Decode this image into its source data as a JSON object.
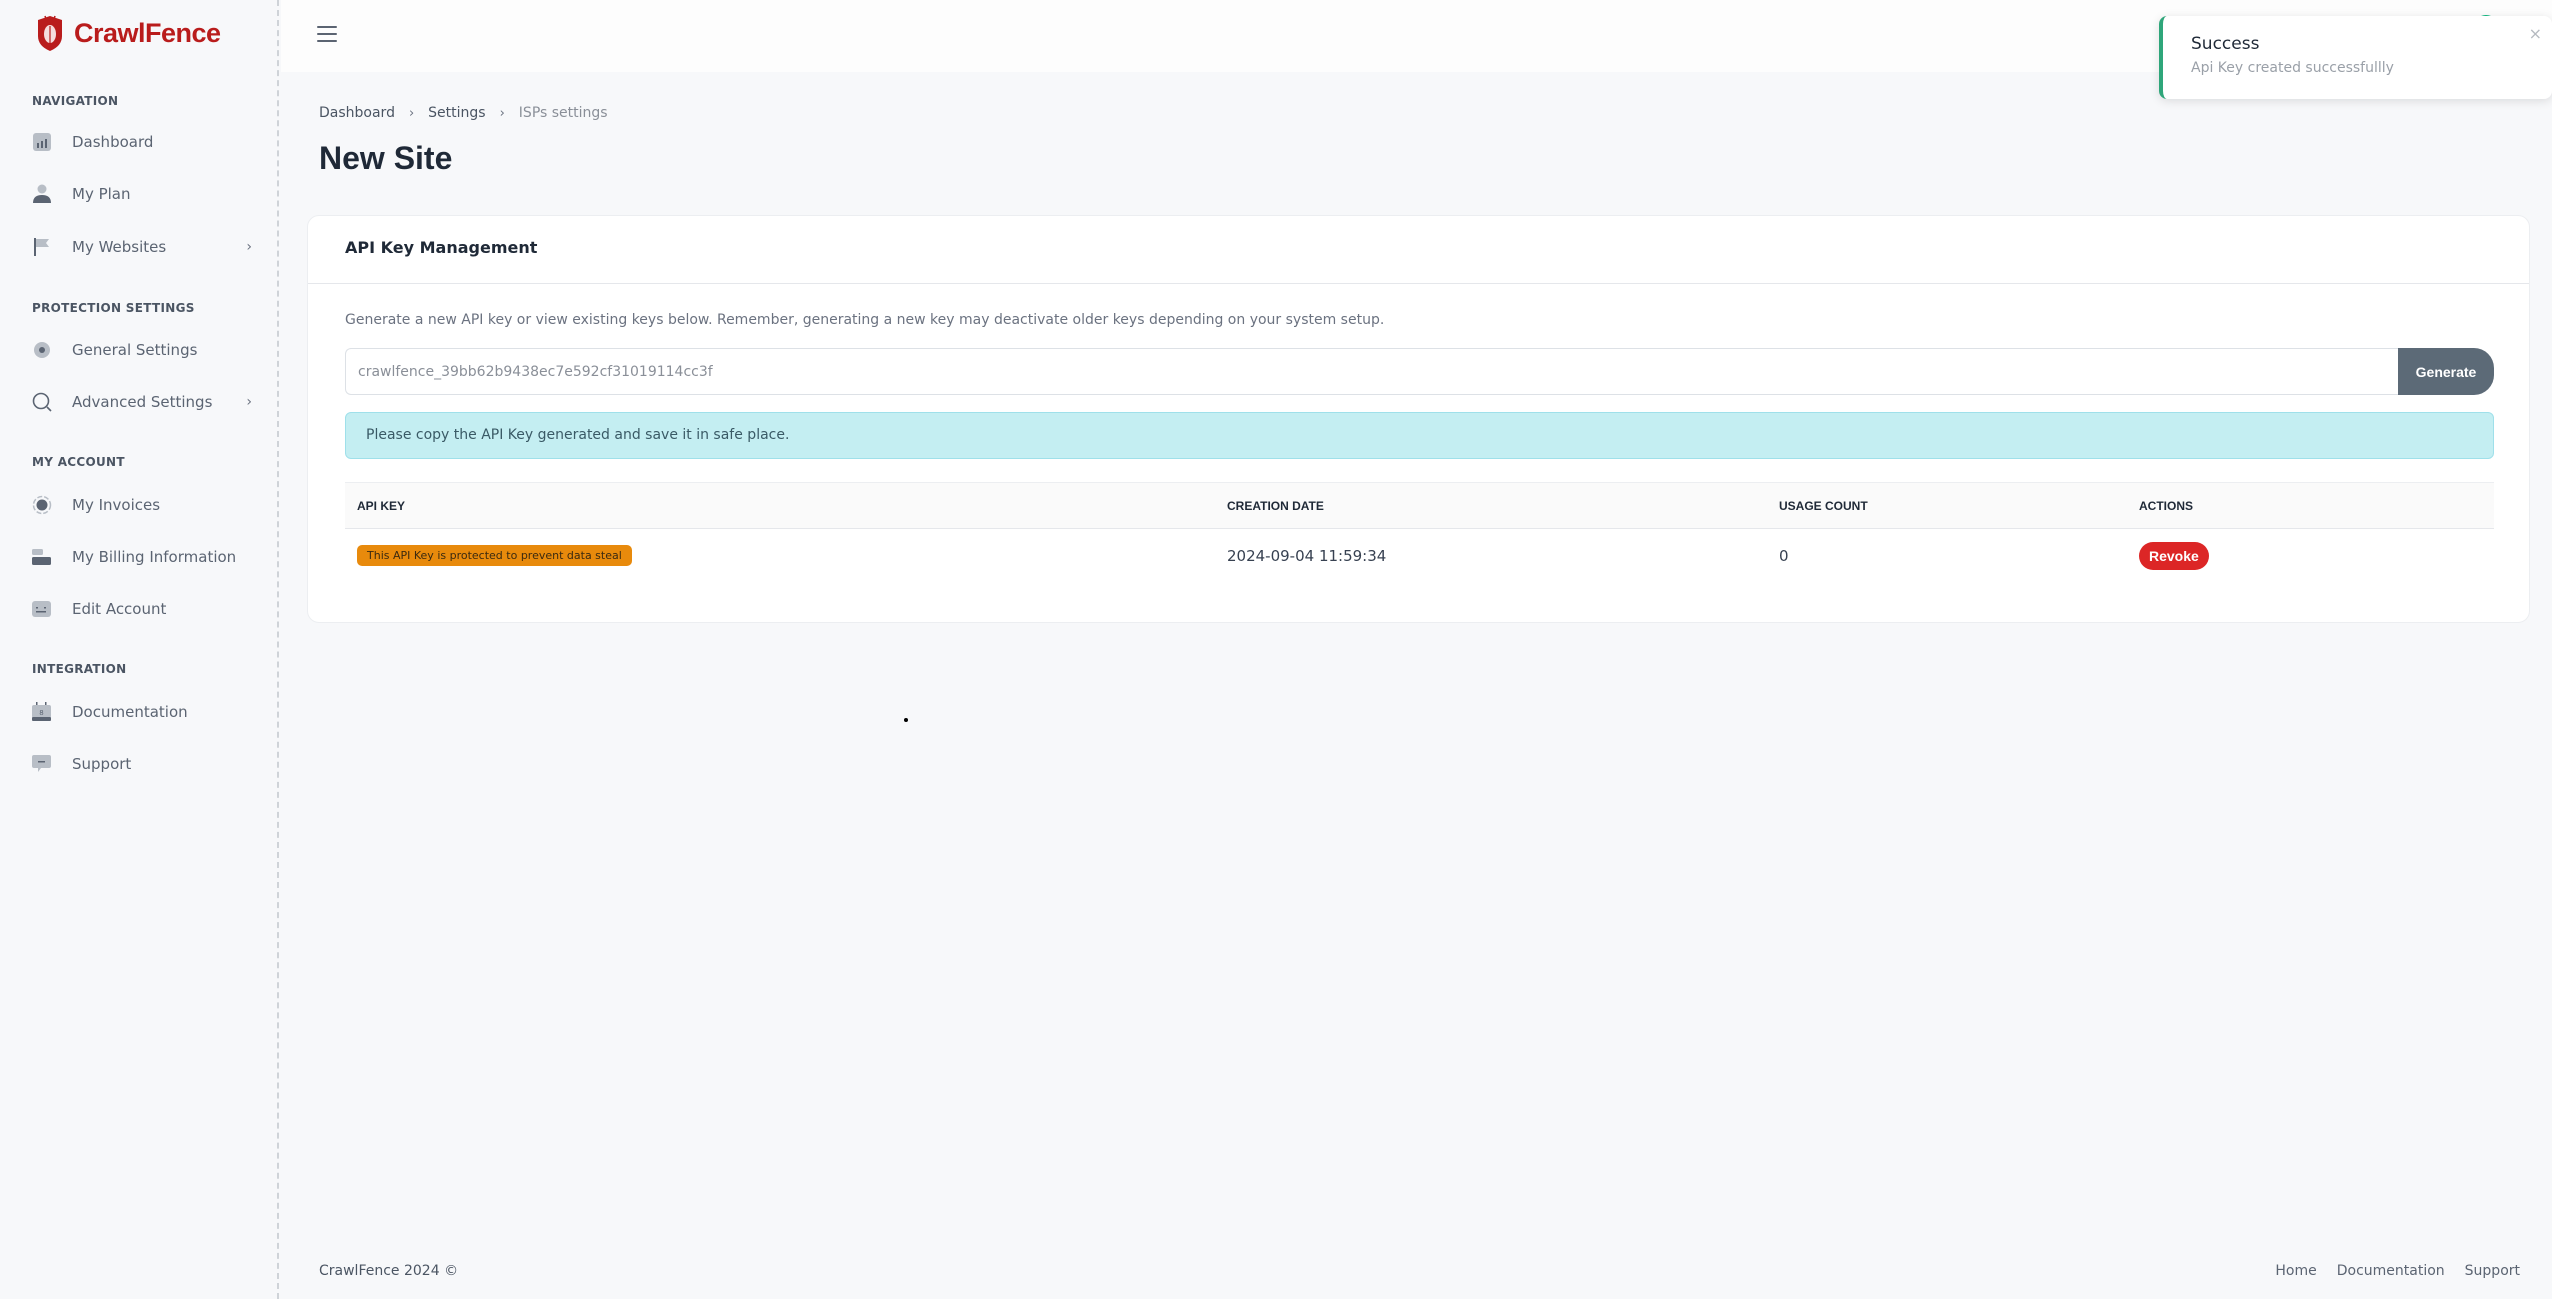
{
  "app": {
    "brand": "CrawlFence",
    "brand_color": "#b91c1c"
  },
  "sidebar": {
    "sections": [
      {
        "title": "NAVIGATION",
        "items": [
          {
            "label": "Dashboard",
            "icon": "chart-icon",
            "has_submenu": false
          },
          {
            "label": "My Plan",
            "icon": "user-icon",
            "has_submenu": false
          },
          {
            "label": "My Websites",
            "icon": "flag-icon",
            "has_submenu": true
          }
        ]
      },
      {
        "title": "PROTECTION SETTINGS",
        "items": [
          {
            "label": "General Settings",
            "icon": "gear-icon",
            "has_submenu": false
          },
          {
            "label": "Advanced Settings",
            "icon": "search-icon",
            "has_submenu": true
          }
        ]
      },
      {
        "title": "MY ACCOUNT",
        "items": [
          {
            "label": "My Invoices",
            "icon": "record-icon",
            "has_submenu": false
          },
          {
            "label": "My Billing Information",
            "icon": "billing-icon",
            "has_submenu": false
          },
          {
            "label": "Edit Account",
            "icon": "keyboard-icon",
            "has_submenu": false
          }
        ]
      },
      {
        "title": "INTEGRATION",
        "items": [
          {
            "label": "Documentation",
            "icon": "calendar-icon",
            "has_submenu": false
          },
          {
            "label": "Support",
            "icon": "chat-icon",
            "has_submenu": false
          }
        ]
      }
    ],
    "chevron": "›"
  },
  "breadcrumb": {
    "items": [
      "Dashboard",
      "Settings",
      "ISPs settings"
    ],
    "separator": "›"
  },
  "page": {
    "title": "New Site"
  },
  "api_card": {
    "title": "API Key Management",
    "description": "Generate a new API key or view existing keys below. Remember, generating a new key may deactivate older keys depending on your system setup.",
    "key_value": "crawlfence_39bb62b9438ec7e592cf31019114cc3f",
    "generate_label": "Generate",
    "alert_text": "Please copy the API Key generated and save it in safe place.",
    "table": {
      "columns": [
        "API KEY",
        "CREATION DATE",
        "USAGE COUNT",
        "ACTIONS"
      ],
      "rows": [
        {
          "api_key": "This API Key is protected to prevent data steal",
          "creation_date": "2024-09-04 11:59:34",
          "usage_count": "0",
          "action": "Revoke"
        }
      ]
    }
  },
  "toast": {
    "title": "Success",
    "message": "Api Key created successfullly",
    "close": "×",
    "accent": "#2fa67a"
  },
  "footer": {
    "copyright": "CrawlFence 2024 ©",
    "links": [
      "Home",
      "Documentation",
      "Support"
    ]
  },
  "colors": {
    "generate_button": "#5c6a77",
    "alert_bg": "#c4eef2",
    "badge_warning": "#e88a0c",
    "revoke_button": "#dc2626",
    "avatar": "#10b981"
  }
}
